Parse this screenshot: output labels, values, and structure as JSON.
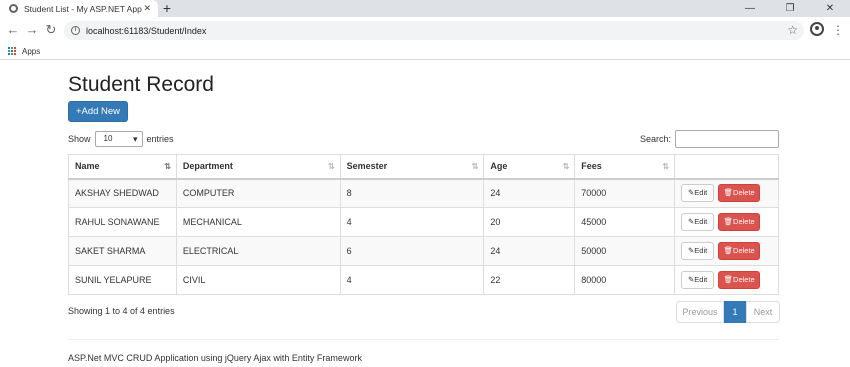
{
  "browser": {
    "tab_title": "Student List - My ASP.NET Applic",
    "url": "localhost:61183/Student/Index",
    "bookmarks_apps": "Apps"
  },
  "page": {
    "title": "Student Record",
    "add_new": "+Add New",
    "show_label": "Show",
    "page_size": "10",
    "entries_label": "entries",
    "search_label": "Search:",
    "columns": [
      "Name",
      "Department",
      "Semester",
      "Age",
      "Fees"
    ],
    "rows": [
      {
        "name": "AKSHAY SHEDWAD",
        "department": "COMPUTER",
        "semester": "8",
        "age": "24",
        "fees": "70000"
      },
      {
        "name": "RAHUL SONAWANE",
        "department": "MECHANICAL",
        "semester": "4",
        "age": "20",
        "fees": "45000"
      },
      {
        "name": "SAKET SHARMA",
        "department": "ELECTRICAL",
        "semester": "6",
        "age": "24",
        "fees": "50000"
      },
      {
        "name": "SUNIL YELAPURE",
        "department": "CIVIL",
        "semester": "4",
        "age": "22",
        "fees": "80000"
      }
    ],
    "edit_label": "✎Edit",
    "delete_label": "🗑Delete",
    "info": "Showing 1 to 4 of 4 entries",
    "pager": {
      "previous": "Previous",
      "current": "1",
      "next": "Next"
    },
    "footer": "ASP.Net MVC CRUD Application using jQuery Ajax with Entity Framework"
  },
  "colors": {
    "primary": "#337ab7",
    "danger": "#d9534f"
  }
}
